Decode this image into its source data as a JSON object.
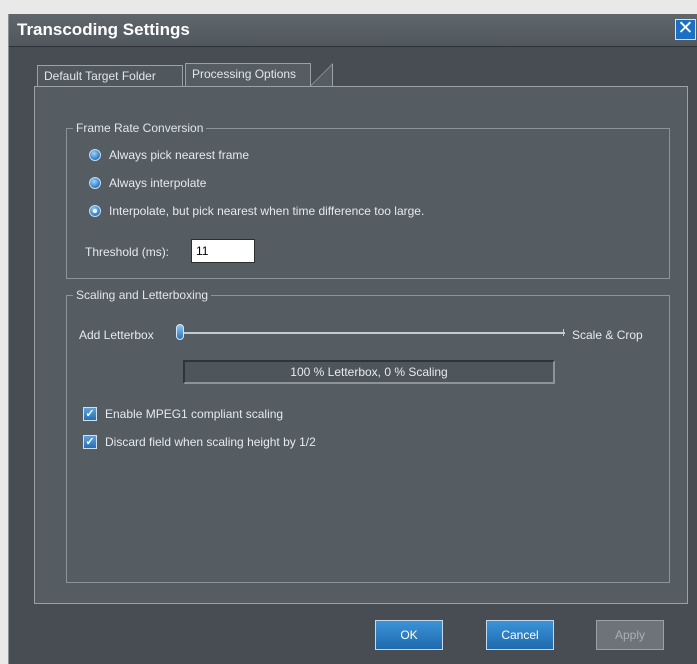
{
  "window": {
    "title": "Transcoding Settings"
  },
  "tabs": [
    {
      "label": "Default Target Folder",
      "active": false
    },
    {
      "label": "Processing Options",
      "active": true
    }
  ],
  "frame_rate": {
    "legend": "Frame Rate Conversion",
    "options": [
      {
        "label": "Always pick nearest frame",
        "checked": false
      },
      {
        "label": "Always interpolate",
        "checked": false
      },
      {
        "label": "Interpolate, but pick nearest when time difference too large.",
        "checked": true
      }
    ],
    "threshold_label": "Threshold (ms):",
    "threshold_value": "11"
  },
  "scaling": {
    "legend": "Scaling and Letterboxing",
    "slider_left_label": "Add Letterbox",
    "slider_right_label": "Scale & Crop",
    "slider_value": 0,
    "status_text": "100 % Letterbox, 0 % Scaling",
    "checkboxes": [
      {
        "label": "Enable MPEG1 compliant scaling",
        "checked": true
      },
      {
        "label": "Discard field when scaling height by 1/2",
        "checked": true
      }
    ]
  },
  "buttons": {
    "ok": "OK",
    "cancel": "Cancel",
    "apply": "Apply"
  },
  "colors": {
    "window_bg": "#474d52",
    "accent": "#1e6aad"
  }
}
